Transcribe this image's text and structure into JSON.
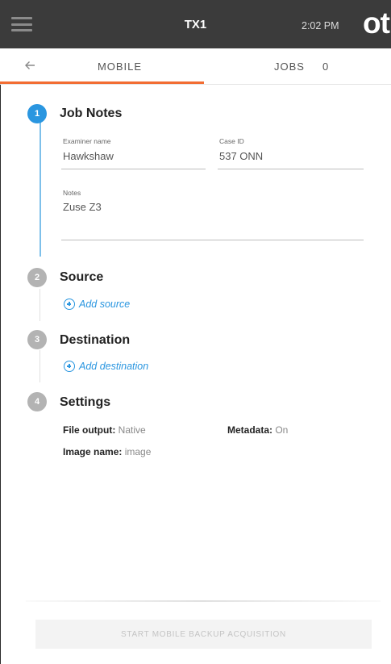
{
  "appbar": {
    "menu_icon": "hamburger-menu-icon",
    "device_name": "TX1",
    "time": "2:02 PM",
    "logo_text": "ot"
  },
  "tabs": {
    "back_icon": "arrow-left-icon",
    "mobile_label": "MOBILE",
    "jobs_label": "JOBS",
    "jobs_count": "0",
    "active_tab_color": "#f26d33"
  },
  "steps": [
    {
      "number": "1",
      "title": "Job Notes",
      "state": "active",
      "fields": {
        "examiner_label": "Examiner name",
        "examiner_value": "Hawkshaw",
        "case_label": "Case ID",
        "case_value": "537 ONN",
        "notes_label": "Notes",
        "notes_value": "Zuse Z3"
      }
    },
    {
      "number": "2",
      "title": "Source",
      "state": "inactive",
      "link_icon": "plus-circle-icon",
      "link_label": "Add source"
    },
    {
      "number": "3",
      "title": "Destination",
      "state": "inactive",
      "link_icon": "plus-circle-icon",
      "link_label": "Add destination"
    },
    {
      "number": "4",
      "title": "Settings",
      "state": "inactive",
      "settings": [
        {
          "key": "File output:",
          "value": "Native"
        },
        {
          "key": "Metadata:",
          "value": "On"
        },
        {
          "key": "Image name:",
          "value": "image"
        }
      ]
    }
  ],
  "footer": {
    "start_label": "START MOBILE BACKUP ACQUISITION"
  },
  "colors": {
    "accent_blue": "#2a96e0",
    "appbar": "#3b3b3b",
    "inactive_step": "#b3b3b3"
  }
}
